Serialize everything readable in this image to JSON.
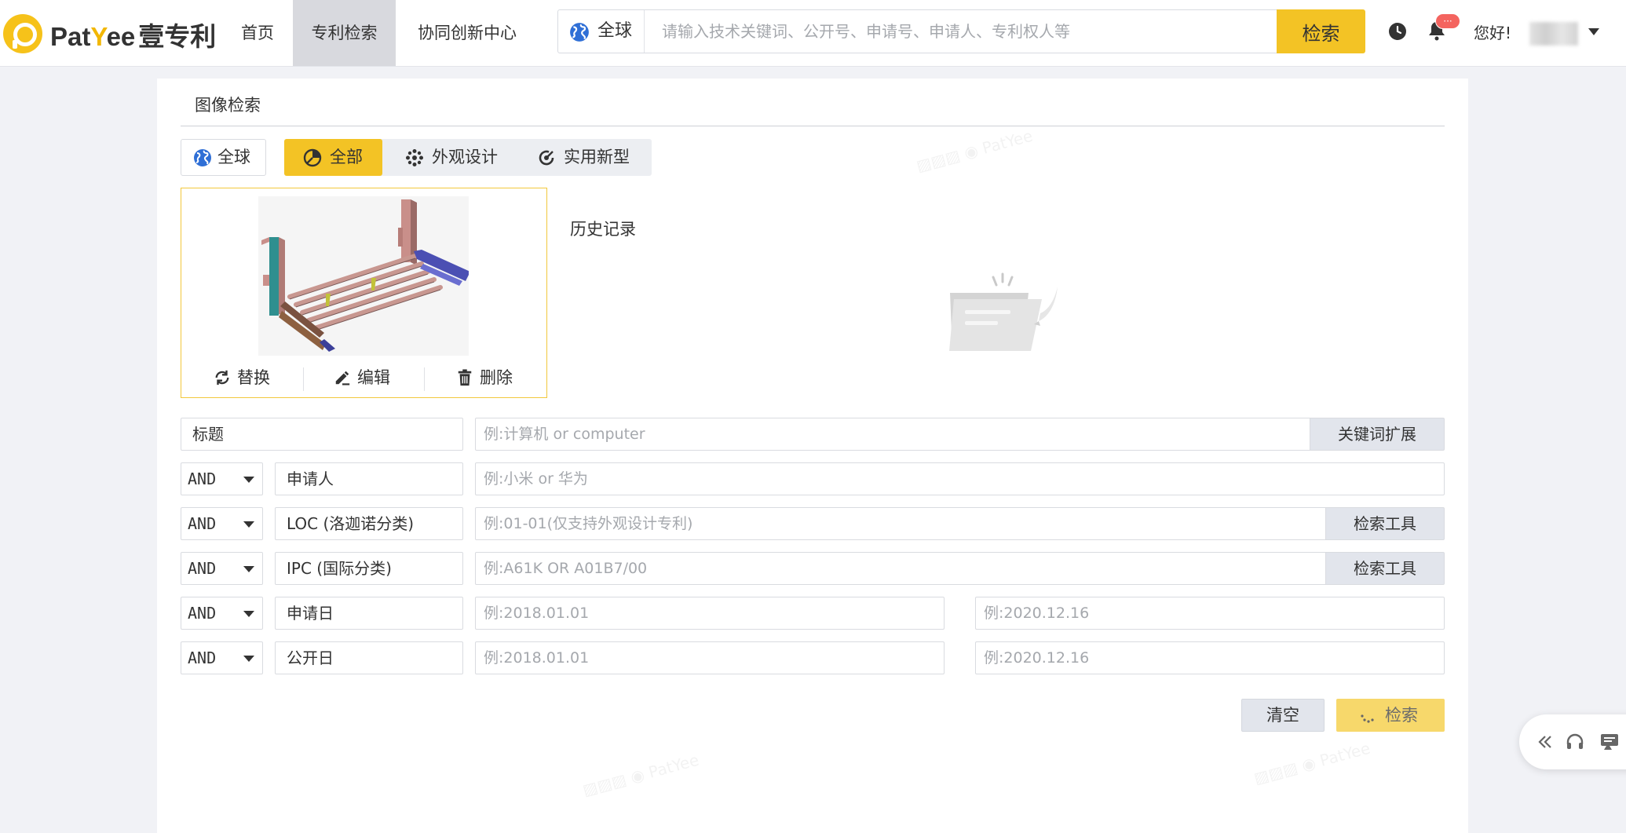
{
  "header": {
    "logo_text_a": "Pat",
    "logo_text_y": "Y",
    "logo_text_b": "ee",
    "logo_text_cn": "壹专利",
    "nav": [
      {
        "label": "首页"
      },
      {
        "label": "专利检索"
      },
      {
        "label": "协同创新中心"
      }
    ],
    "search": {
      "region": "全球",
      "placeholder": "请输入技术关键词、公开号、申请号、申请人、专利权人等",
      "button": "检索"
    },
    "notification_badge": "···",
    "greeting": "您好!"
  },
  "panel": {
    "title": "图像检索",
    "region_button": "全球",
    "type_tabs": [
      {
        "label": "全部",
        "active": true
      },
      {
        "label": "外观设计",
        "active": false
      },
      {
        "label": "实用新型",
        "active": false
      }
    ],
    "image_actions": {
      "replace": "替换",
      "edit": "编辑",
      "delete": "删除"
    },
    "history_title": "历史记录"
  },
  "form": {
    "rows": [
      {
        "operator": "",
        "field": "标题",
        "placeholder": "例:计算机 or computer",
        "tool": "关键词扩展"
      },
      {
        "operator": "AND",
        "field": "申请人",
        "placeholder": "例:小米 or 华为",
        "tool": ""
      },
      {
        "operator": "AND",
        "field": "LOC (洛迦诺分类)",
        "placeholder": "例:01-01(仅支持外观设计专利)",
        "tool": "检索工具"
      },
      {
        "operator": "AND",
        "field": "IPC (国际分类)",
        "placeholder": "例:A61K OR A01B7/00",
        "tool": "检索工具"
      },
      {
        "operator": "AND",
        "field": "申请日",
        "placeholder_from": "例:2018.01.01",
        "placeholder_to": "例:2020.12.16"
      },
      {
        "operator": "AND",
        "field": "公开日",
        "placeholder_from": "例:2018.01.01",
        "placeholder_to": "例:2020.12.16"
      }
    ],
    "clear_button": "清空",
    "search_button": "检索"
  },
  "colors": {
    "accent": "#f3c325",
    "accent_disabled": "#f7d86b",
    "badge": "#f4645f"
  }
}
